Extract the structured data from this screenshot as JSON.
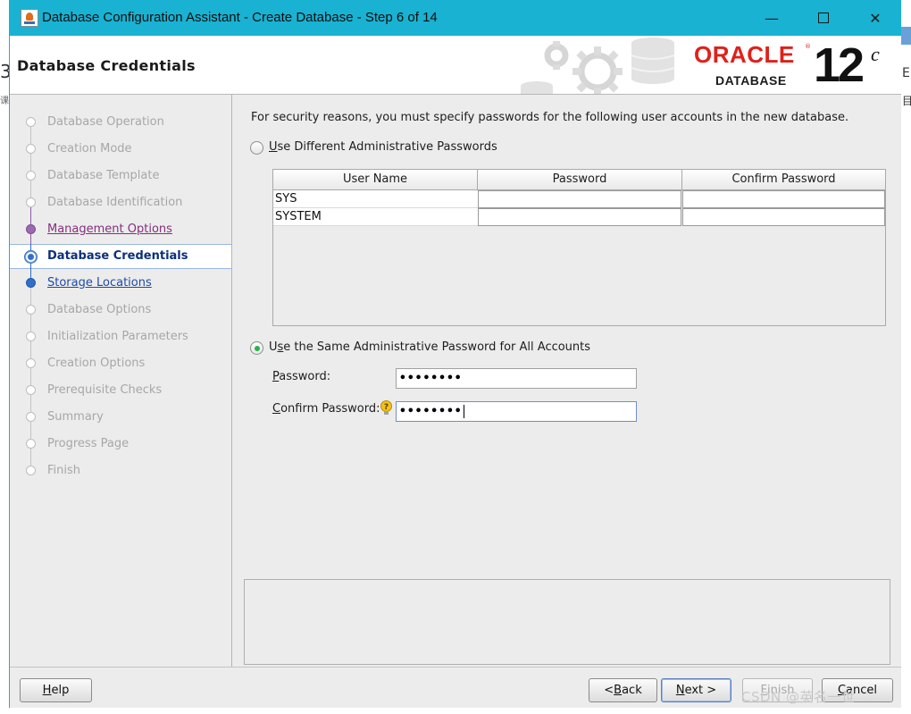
{
  "window": {
    "title": "Database Configuration Assistant - Create Database - Step 6 of 14",
    "minimize": "—",
    "close": "✕"
  },
  "banner": {
    "heading": "Database Credentials",
    "logo_word": "ORACLE",
    "logo_reg": "®",
    "logo_sub": "DATABASE",
    "version": "12",
    "version_sup": "c"
  },
  "steps": [
    {
      "label": "Database Operation",
      "state": "disabled"
    },
    {
      "label": "Creation Mode",
      "state": "disabled"
    },
    {
      "label": "Database Template",
      "state": "disabled"
    },
    {
      "label": "Database Identification",
      "state": "disabled"
    },
    {
      "label": "Management Options",
      "state": "visited"
    },
    {
      "label": "Database Credentials",
      "state": "current"
    },
    {
      "label": "Storage Locations",
      "state": "link"
    },
    {
      "label": "Database Options",
      "state": "disabled"
    },
    {
      "label": "Initialization Parameters",
      "state": "disabled"
    },
    {
      "label": "Creation Options",
      "state": "disabled"
    },
    {
      "label": "Prerequisite Checks",
      "state": "disabled"
    },
    {
      "label": "Summary",
      "state": "disabled"
    },
    {
      "label": "Progress Page",
      "state": "disabled"
    },
    {
      "label": "Finish",
      "state": "disabled"
    }
  ],
  "main": {
    "intro": "For security reasons, you must specify passwords for the following user accounts in the new database.",
    "option_different": {
      "mnemonic": "U",
      "rest": "se Different Administrative Passwords",
      "selected": false
    },
    "table": {
      "headers": [
        "User Name",
        "Password",
        "Confirm Password"
      ],
      "rows": [
        {
          "user": "SYS",
          "password": "",
          "confirm": ""
        },
        {
          "user": "SYSTEM",
          "password": "",
          "confirm": ""
        }
      ]
    },
    "option_same": {
      "pre": "U",
      "mnemonic": "s",
      "rest": "e the Same Administrative Password for All Accounts",
      "selected": true
    },
    "password": {
      "mnemonic": "P",
      "rest": "assword:",
      "value": "••••••••"
    },
    "confirm": {
      "mnemonic": "C",
      "rest": "onfirm Password:",
      "value": "••••••••"
    }
  },
  "buttons": {
    "help": {
      "mnemonic": "H",
      "rest": "elp"
    },
    "back": {
      "pre": "< ",
      "mnemonic": "B",
      "rest": "ack"
    },
    "next": {
      "mnemonic": "N",
      "rest": "ext >"
    },
    "finish": {
      "mnemonic": "F",
      "rest": "inish"
    },
    "cancel": {
      "mnemonic": "C",
      "rest": "ancel"
    }
  },
  "colors": {
    "titlebar": "#19b2d2",
    "oracle_red": "#e0201a",
    "visited_step": "#84307e",
    "link_step": "#1e4aa6",
    "current_step": "#0b2f7a"
  },
  "watermark": "CSDN @英名一世"
}
